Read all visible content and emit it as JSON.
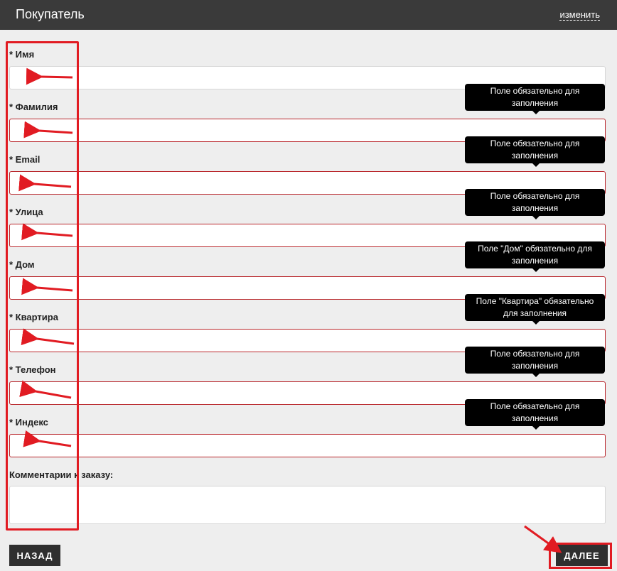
{
  "header": {
    "title": "Покупатель",
    "change_link": "изменить"
  },
  "fields": [
    {
      "label": "* Имя",
      "value": "",
      "error": false,
      "tooltip": ""
    },
    {
      "label": "* Фамилия",
      "value": "",
      "error": true,
      "tooltip": "Поле обязательно для заполнения"
    },
    {
      "label": "* Email",
      "value": "",
      "error": true,
      "tooltip": "Поле обязательно для заполнения"
    },
    {
      "label": "* Улица",
      "value": "",
      "error": true,
      "tooltip": "Поле обязательно для заполнения"
    },
    {
      "label": "* Дом",
      "value": "",
      "error": true,
      "tooltip": "Поле \"Дом\" обязательно для заполнения"
    },
    {
      "label": "* Квартира",
      "value": "",
      "error": true,
      "tooltip": "Поле \"Квартира\" обязательно для заполнения"
    },
    {
      "label": "* Телефон",
      "value": "",
      "error": true,
      "tooltip": "Поле обязательно для заполнения"
    },
    {
      "label": "* Индекс",
      "value": "",
      "error": true,
      "tooltip": "Поле обязательно для заполнения"
    }
  ],
  "comment": {
    "label": "Комментарии к заказу:",
    "value": ""
  },
  "buttons": {
    "back": "НАЗАД",
    "next": "ДАЛЕЕ"
  },
  "colors": {
    "header_bg": "#3a3a3a",
    "error_border": "#b9262b",
    "annotation_red": "#e11b22"
  }
}
